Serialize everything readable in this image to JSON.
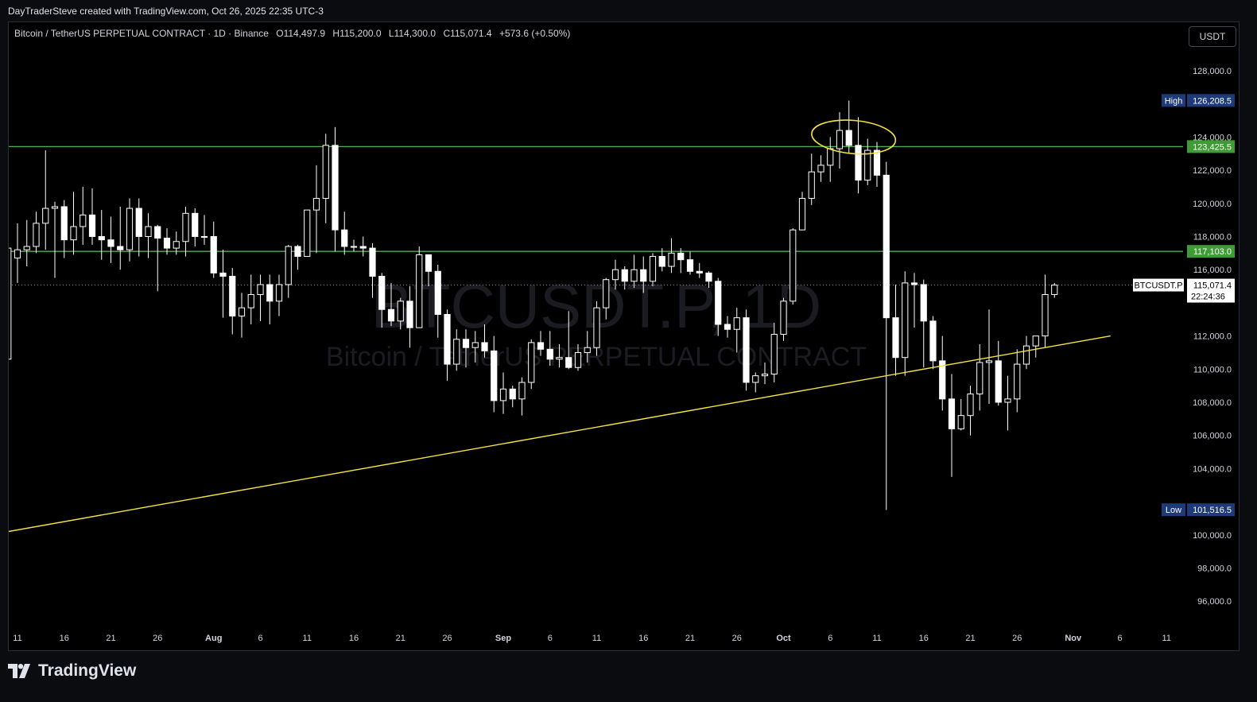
{
  "header": {
    "attribution": "DayTraderSteve created with TradingView.com, Oct 26, 2025 22:35 UTC-3"
  },
  "legend": {
    "symbol": "Bitcoin / TetherUS PERPETUAL CONTRACT · 1D · Binance",
    "open": "O114,497.9",
    "high": "H115,200.0",
    "low": "L114,300.0",
    "close": "C115,071.4",
    "change": "+573.6 (+0.50%)"
  },
  "currency_button": "USDT",
  "watermark": {
    "symbol": "BTCUSDT.P, 1D",
    "name": "Bitcoin / TetherUS PERPETUAL CONTRACT"
  },
  "brand": "TradingView",
  "colors": {
    "background": "#000000",
    "candle": "#ffffff",
    "hline": "#4caf50",
    "trendline": "#f5e342",
    "annotation": "#f5e342",
    "badge_blue": "#1e3a7a",
    "badge_green": "#3f9c35"
  },
  "chart_data": {
    "type": "candlestick",
    "y_axis": {
      "range": [
        95000,
        129500
      ],
      "ticks": [
        "128,000.0",
        "124,000.0",
        "122,000.0",
        "120,000.0",
        "118,000.0",
        "116,000.0",
        "112,000.0",
        "110,000.0",
        "108,000.0",
        "106,000.0",
        "104,000.0",
        "100,000.0",
        "98,000.0",
        "96,000.0"
      ]
    },
    "x_axis": {
      "ticks": [
        {
          "label": "11",
          "day": 0
        },
        {
          "label": "16",
          "day": 5
        },
        {
          "label": "21",
          "day": 10
        },
        {
          "label": "26",
          "day": 15
        },
        {
          "label": "Aug",
          "day": 21,
          "bold": true
        },
        {
          "label": "6",
          "day": 26
        },
        {
          "label": "11",
          "day": 31
        },
        {
          "label": "16",
          "day": 36
        },
        {
          "label": "21",
          "day": 41
        },
        {
          "label": "26",
          "day": 46
        },
        {
          "label": "Sep",
          "day": 52,
          "bold": true
        },
        {
          "label": "6",
          "day": 57
        },
        {
          "label": "11",
          "day": 62
        },
        {
          "label": "16",
          "day": 67
        },
        {
          "label": "21",
          "day": 72
        },
        {
          "label": "26",
          "day": 77
        },
        {
          "label": "Oct",
          "day": 82,
          "bold": true
        },
        {
          "label": "6",
          "day": 87
        },
        {
          "label": "11",
          "day": 92
        },
        {
          "label": "16",
          "day": 97
        },
        {
          "label": "21",
          "day": 102
        },
        {
          "label": "26",
          "day": 107
        },
        {
          "label": "Nov",
          "day": 113,
          "bold": true
        },
        {
          "label": "6",
          "day": 118
        },
        {
          "label": "11",
          "day": 123
        }
      ]
    },
    "candles": [
      {
        "d": -1,
        "o": 110600,
        "h": 117300,
        "l": 110600,
        "c": 117300
      },
      {
        "d": 0,
        "o": 116700,
        "h": 118800,
        "l": 115200,
        "c": 117200
      },
      {
        "d": 1,
        "o": 117200,
        "h": 119000,
        "l": 116200,
        "c": 117400
      },
      {
        "d": 2,
        "o": 117400,
        "h": 119500,
        "l": 117000,
        "c": 118800
      },
      {
        "d": 3,
        "o": 118800,
        "h": 123200,
        "l": 117200,
        "c": 119700
      },
      {
        "d": 4,
        "o": 119700,
        "h": 120100,
        "l": 115500,
        "c": 119800
      },
      {
        "d": 5,
        "o": 119800,
        "h": 120200,
        "l": 116700,
        "c": 117800
      },
      {
        "d": 6,
        "o": 117800,
        "h": 120700,
        "l": 116900,
        "c": 118600
      },
      {
        "d": 7,
        "o": 118600,
        "h": 121000,
        "l": 117500,
        "c": 119300
      },
      {
        "d": 8,
        "o": 119300,
        "h": 120900,
        "l": 117500,
        "c": 118000
      },
      {
        "d": 9,
        "o": 118000,
        "h": 119600,
        "l": 116600,
        "c": 117800
      },
      {
        "d": 10,
        "o": 117800,
        "h": 119200,
        "l": 116400,
        "c": 117400
      },
      {
        "d": 11,
        "o": 117400,
        "h": 119800,
        "l": 116000,
        "c": 117200
      },
      {
        "d": 12,
        "o": 117200,
        "h": 120300,
        "l": 116500,
        "c": 119700
      },
      {
        "d": 13,
        "o": 119700,
        "h": 120300,
        "l": 116800,
        "c": 118000
      },
      {
        "d": 14,
        "o": 118000,
        "h": 119400,
        "l": 116700,
        "c": 118600
      },
      {
        "d": 15,
        "o": 118600,
        "h": 118700,
        "l": 114700,
        "c": 117900
      },
      {
        "d": 16,
        "o": 117900,
        "h": 118500,
        "l": 116900,
        "c": 117300
      },
      {
        "d": 17,
        "o": 117300,
        "h": 118300,
        "l": 116900,
        "c": 117700
      },
      {
        "d": 18,
        "o": 117700,
        "h": 119800,
        "l": 116800,
        "c": 119400
      },
      {
        "d": 19,
        "o": 119400,
        "h": 119700,
        "l": 117400,
        "c": 118000
      },
      {
        "d": 20,
        "o": 118000,
        "h": 119300,
        "l": 117500,
        "c": 118000
      },
      {
        "d": 21,
        "o": 118000,
        "h": 118900,
        "l": 115500,
        "c": 115800
      },
      {
        "d": 22,
        "o": 115800,
        "h": 117200,
        "l": 113100,
        "c": 115600
      },
      {
        "d": 23,
        "o": 115600,
        "h": 116100,
        "l": 112100,
        "c": 113200
      },
      {
        "d": 24,
        "o": 113200,
        "h": 114600,
        "l": 111900,
        "c": 113700
      },
      {
        "d": 25,
        "o": 113700,
        "h": 115700,
        "l": 112700,
        "c": 114500
      },
      {
        "d": 26,
        "o": 114500,
        "h": 115700,
        "l": 112900,
        "c": 115100
      },
      {
        "d": 27,
        "o": 115100,
        "h": 115700,
        "l": 112700,
        "c": 114100
      },
      {
        "d": 28,
        "o": 114100,
        "h": 115700,
        "l": 113200,
        "c": 115100
      },
      {
        "d": 29,
        "o": 115100,
        "h": 117500,
        "l": 114300,
        "c": 117400
      },
      {
        "d": 30,
        "o": 117400,
        "h": 117500,
        "l": 116000,
        "c": 116800
      },
      {
        "d": 31,
        "o": 116800,
        "h": 119500,
        "l": 116800,
        "c": 119600
      },
      {
        "d": 32,
        "o": 119600,
        "h": 122300,
        "l": 117000,
        "c": 120300
      },
      {
        "d": 33,
        "o": 120300,
        "h": 124200,
        "l": 118800,
        "c": 123500
      },
      {
        "d": 34,
        "o": 123500,
        "h": 124600,
        "l": 117100,
        "c": 118400
      },
      {
        "d": 35,
        "o": 118400,
        "h": 119500,
        "l": 116900,
        "c": 117400
      },
      {
        "d": 36,
        "o": 117400,
        "h": 117800,
        "l": 117100,
        "c": 117400
      },
      {
        "d": 37,
        "o": 117400,
        "h": 118000,
        "l": 116800,
        "c": 117300
      },
      {
        "d": 38,
        "o": 117300,
        "h": 117600,
        "l": 114300,
        "c": 115600
      },
      {
        "d": 39,
        "o": 115600,
        "h": 115800,
        "l": 112500,
        "c": 113600
      },
      {
        "d": 40,
        "o": 113600,
        "h": 115200,
        "l": 112600,
        "c": 112900
      },
      {
        "d": 41,
        "o": 112900,
        "h": 114300,
        "l": 112400,
        "c": 114100
      },
      {
        "d": 42,
        "o": 114100,
        "h": 115000,
        "l": 111300,
        "c": 112500
      },
      {
        "d": 43,
        "o": 112500,
        "h": 117400,
        "l": 112500,
        "c": 116900
      },
      {
        "d": 44,
        "o": 116900,
        "h": 116900,
        "l": 115000,
        "c": 115900
      },
      {
        "d": 45,
        "o": 115900,
        "h": 116300,
        "l": 111900,
        "c": 113300
      },
      {
        "d": 46,
        "o": 113300,
        "h": 113600,
        "l": 109300,
        "c": 110300
      },
      {
        "d": 47,
        "o": 110300,
        "h": 112400,
        "l": 109900,
        "c": 111800
      },
      {
        "d": 48,
        "o": 111800,
        "h": 112400,
        "l": 110100,
        "c": 111300
      },
      {
        "d": 49,
        "o": 111300,
        "h": 112300,
        "l": 110400,
        "c": 111600
      },
      {
        "d": 50,
        "o": 111600,
        "h": 112700,
        "l": 110700,
        "c": 111100
      },
      {
        "d": 51,
        "o": 111100,
        "h": 112000,
        "l": 107400,
        "c": 108100
      },
      {
        "d": 52,
        "o": 108100,
        "h": 109800,
        "l": 107300,
        "c": 108800
      },
      {
        "d": 53,
        "o": 108800,
        "h": 109000,
        "l": 107700,
        "c": 108200
      },
      {
        "d": 54,
        "o": 108200,
        "h": 109500,
        "l": 107200,
        "c": 109200
      },
      {
        "d": 55,
        "o": 109200,
        "h": 111800,
        "l": 108800,
        "c": 111600
      },
      {
        "d": 56,
        "o": 111600,
        "h": 112300,
        "l": 110800,
        "c": 111200
      },
      {
        "d": 57,
        "o": 111200,
        "h": 112300,
        "l": 110200,
        "c": 110600
      },
      {
        "d": 58,
        "o": 110600,
        "h": 111500,
        "l": 110100,
        "c": 110700
      },
      {
        "d": 59,
        "o": 110700,
        "h": 113500,
        "l": 110000,
        "c": 110100
      },
      {
        "d": 60,
        "o": 110100,
        "h": 111500,
        "l": 109900,
        "c": 111000
      },
      {
        "d": 61,
        "o": 111000,
        "h": 112300,
        "l": 110400,
        "c": 111300
      },
      {
        "d": 62,
        "o": 111300,
        "h": 114100,
        "l": 110800,
        "c": 113700
      },
      {
        "d": 63,
        "o": 113700,
        "h": 115500,
        "l": 113000,
        "c": 115400
      },
      {
        "d": 64,
        "o": 115400,
        "h": 116600,
        "l": 114800,
        "c": 116000
      },
      {
        "d": 65,
        "o": 116000,
        "h": 116200,
        "l": 114800,
        "c": 115300
      },
      {
        "d": 66,
        "o": 115300,
        "h": 116900,
        "l": 114900,
        "c": 116000
      },
      {
        "d": 67,
        "o": 116000,
        "h": 116800,
        "l": 114600,
        "c": 115300
      },
      {
        "d": 68,
        "o": 115300,
        "h": 117000,
        "l": 115000,
        "c": 116800
      },
      {
        "d": 69,
        "o": 116800,
        "h": 117300,
        "l": 115900,
        "c": 116200
      },
      {
        "d": 70,
        "o": 116200,
        "h": 117900,
        "l": 115800,
        "c": 117000
      },
      {
        "d": 71,
        "o": 117000,
        "h": 117300,
        "l": 115800,
        "c": 116600
      },
      {
        "d": 72,
        "o": 116600,
        "h": 117100,
        "l": 115700,
        "c": 115900
      },
      {
        "d": 73,
        "o": 115900,
        "h": 116400,
        "l": 115500,
        "c": 115800
      },
      {
        "d": 74,
        "o": 115800,
        "h": 115900,
        "l": 114900,
        "c": 115300
      },
      {
        "d": 75,
        "o": 115300,
        "h": 115500,
        "l": 112000,
        "c": 112700
      },
      {
        "d": 76,
        "o": 112700,
        "h": 113200,
        "l": 111900,
        "c": 112400
      },
      {
        "d": 77,
        "o": 112400,
        "h": 113700,
        "l": 111000,
        "c": 113100
      },
      {
        "d": 78,
        "o": 113100,
        "h": 113600,
        "l": 108700,
        "c": 109200
      },
      {
        "d": 79,
        "o": 109200,
        "h": 109800,
        "l": 108600,
        "c": 109600
      },
      {
        "d": 80,
        "o": 109600,
        "h": 110400,
        "l": 109100,
        "c": 109700
      },
      {
        "d": 81,
        "o": 109700,
        "h": 112800,
        "l": 109200,
        "c": 112100
      },
      {
        "d": 82,
        "o": 112100,
        "h": 114300,
        "l": 111700,
        "c": 114100
      },
      {
        "d": 83,
        "o": 114100,
        "h": 118500,
        "l": 113900,
        "c": 118400
      },
      {
        "d": 84,
        "o": 118400,
        "h": 120700,
        "l": 118400,
        "c": 120300
      },
      {
        "d": 85,
        "o": 120300,
        "h": 123000,
        "l": 119900,
        "c": 121900
      },
      {
        "d": 86,
        "o": 121900,
        "h": 122900,
        "l": 121300,
        "c": 122300
      },
      {
        "d": 87,
        "o": 122300,
        "h": 124000,
        "l": 121300,
        "c": 123300
      },
      {
        "d": 88,
        "o": 123300,
        "h": 125500,
        "l": 122100,
        "c": 124400
      },
      {
        "d": 89,
        "o": 124400,
        "h": 126200,
        "l": 123000,
        "c": 123500
      },
      {
        "d": 90,
        "o": 123500,
        "h": 125200,
        "l": 120600,
        "c": 121400
      },
      {
        "d": 91,
        "o": 121400,
        "h": 123900,
        "l": 121100,
        "c": 123200
      },
      {
        "d": 92,
        "o": 123200,
        "h": 123700,
        "l": 121000,
        "c": 121700
      },
      {
        "d": 93,
        "o": 121700,
        "h": 122500,
        "l": 101500,
        "c": 113100
      },
      {
        "d": 94,
        "o": 113100,
        "h": 115100,
        "l": 109600,
        "c": 110700
      },
      {
        "d": 95,
        "o": 110700,
        "h": 115900,
        "l": 109600,
        "c": 115200
      },
      {
        "d": 96,
        "o": 115200,
        "h": 115800,
        "l": 112500,
        "c": 115100
      },
      {
        "d": 97,
        "o": 115100,
        "h": 115400,
        "l": 110100,
        "c": 112900
      },
      {
        "d": 98,
        "o": 112900,
        "h": 113200,
        "l": 110000,
        "c": 110500
      },
      {
        "d": 99,
        "o": 110500,
        "h": 112000,
        "l": 107500,
        "c": 108200
      },
      {
        "d": 100,
        "o": 108200,
        "h": 109700,
        "l": 103500,
        "c": 106400
      },
      {
        "d": 101,
        "o": 106400,
        "h": 108200,
        "l": 106300,
        "c": 107200
      },
      {
        "d": 102,
        "o": 107200,
        "h": 109000,
        "l": 106000,
        "c": 108500
      },
      {
        "d": 103,
        "o": 108500,
        "h": 111500,
        "l": 107500,
        "c": 110400
      },
      {
        "d": 104,
        "o": 110400,
        "h": 113600,
        "l": 107900,
        "c": 110500
      },
      {
        "d": 105,
        "o": 110500,
        "h": 111700,
        "l": 107800,
        "c": 108000
      },
      {
        "d": 106,
        "o": 108000,
        "h": 109600,
        "l": 106300,
        "c": 108200
      },
      {
        "d": 107,
        "o": 108200,
        "h": 111200,
        "l": 107400,
        "c": 110300
      },
      {
        "d": 108,
        "o": 110300,
        "h": 112000,
        "l": 110000,
        "c": 111400
      },
      {
        "d": 109,
        "o": 111400,
        "h": 112000,
        "l": 110700,
        "c": 112000
      },
      {
        "d": 110,
        "o": 112000,
        "h": 115700,
        "l": 111300,
        "c": 114500
      },
      {
        "d": 111,
        "o": 114500,
        "h": 115200,
        "l": 114300,
        "c": 115071.4
      }
    ],
    "horizontal_lines": [
      {
        "price": 123425.5,
        "label": "123,425.5"
      },
      {
        "price": 117103.0,
        "label": "117,103.0"
      }
    ],
    "trendline": {
      "from": {
        "day": -1,
        "price": 100200
      },
      "to": {
        "day": 117,
        "price": 112000
      }
    },
    "annotation_ellipse": {
      "day": 89.5,
      "price": 124000,
      "w_days": 9,
      "h_price": 2000
    },
    "high_marker": {
      "tag": "High",
      "label": "126,208.5",
      "price": 126208.5
    },
    "low_marker": {
      "tag": "Low",
      "label": "101,516.5",
      "price": 101516.5
    },
    "last_price": {
      "symbol": "BTCUSDT.P",
      "label": "115,071.4",
      "price": 115071.4,
      "countdown": "22:24:36"
    }
  }
}
